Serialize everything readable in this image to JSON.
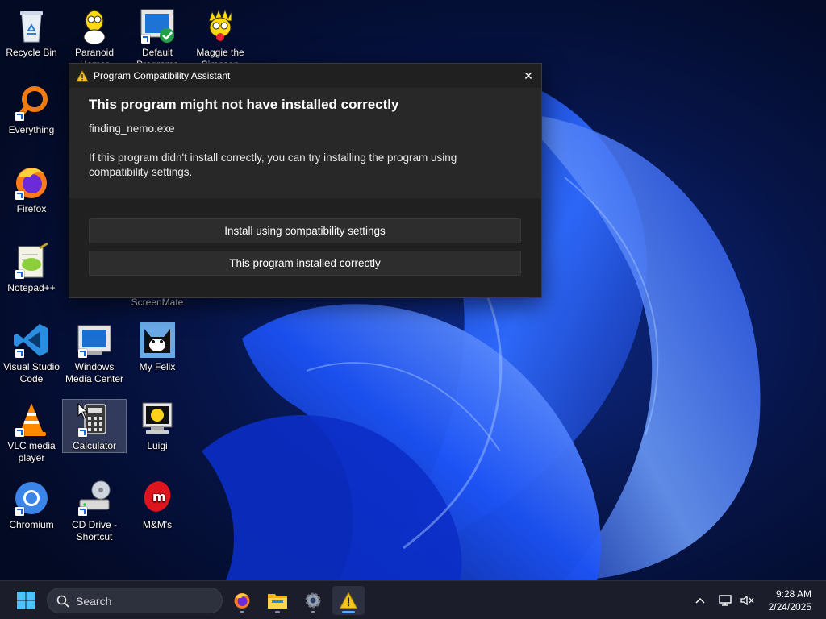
{
  "desktop": {
    "icons": [
      {
        "label": "Recycle Bin",
        "icon": "recycle-bin-icon"
      },
      {
        "label": "Paranoid Homer",
        "icon": "homer-icon"
      },
      {
        "label": "Default Programs",
        "icon": "default-programs-icon"
      },
      {
        "label": "Maggie the Simpson",
        "icon": "maggie-icon"
      },
      {
        "label": "Everything",
        "icon": "everything-search-icon"
      },
      {
        "label": "Firefox",
        "icon": "firefox-icon"
      },
      {
        "label": "Notepad++",
        "icon": "notepadpp-icon"
      },
      {
        "label": "ScreenMate",
        "icon": "screenmate-icon"
      },
      {
        "label": "Visual Studio Code",
        "icon": "vscode-icon"
      },
      {
        "label": "Windows Media Center",
        "icon": "media-center-icon"
      },
      {
        "label": "My Felix",
        "icon": "felix-cat-icon"
      },
      {
        "label": "VLC media player",
        "icon": "vlc-icon"
      },
      {
        "label": "Calculator",
        "icon": "calculator-icon"
      },
      {
        "label": "Luigi",
        "icon": "luigi-icon"
      },
      {
        "label": "Chromium",
        "icon": "chromium-icon"
      },
      {
        "label": "CD Drive - Shortcut",
        "icon": "cd-drive-icon"
      },
      {
        "label": "M&M's",
        "icon": "mms-icon"
      }
    ]
  },
  "dialog": {
    "title": "Program Compatibility Assistant",
    "heading": "This program might not have installed correctly",
    "program": "finding_nemo.exe",
    "message": "If this program didn't install correctly, you can try installing the program using compatibility settings.",
    "button_primary": "Install using compatibility settings",
    "button_secondary": "This program installed correctly",
    "close_symbol": "✕"
  },
  "taskbar": {
    "search_placeholder": "Search",
    "pinned": [
      "start-icon",
      "firefox-icon",
      "file-explorer-icon",
      "settings-icon",
      "warning-icon"
    ],
    "clock_time": "9:28 AM",
    "clock_date": "2/24/2025"
  },
  "colors": {
    "dialog_bg": "#202020",
    "dialog_upper": "#282828",
    "button_bg": "#2d2d2d",
    "taskbar_bg": "#1b1e2a",
    "accent": "#5ea8ff",
    "wallpaper_blue": "#1d4fe0"
  }
}
